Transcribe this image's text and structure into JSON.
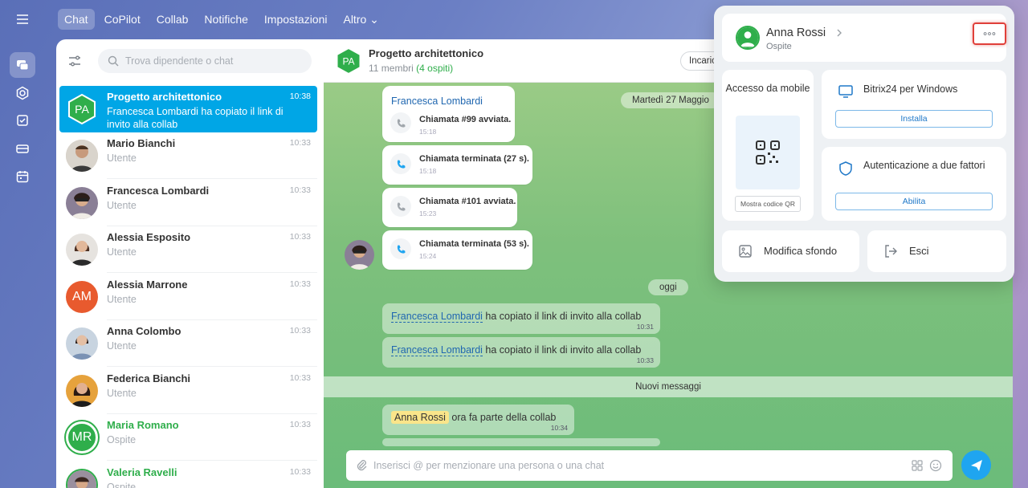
{
  "nav": {
    "tabs": [
      {
        "label": "Chat",
        "active": true
      },
      {
        "label": "CoPilot"
      },
      {
        "label": "Collab"
      },
      {
        "label": "Notifiche"
      },
      {
        "label": "Impostazioni"
      },
      {
        "label": "Altro ⌄"
      }
    ]
  },
  "rail_icons": [
    "menu-icon",
    "chat-icon",
    "hexagon-icon",
    "tasks-icon",
    "drive-icon",
    "calendar-icon"
  ],
  "search": {
    "placeholder": "Trova dipendente o chat"
  },
  "chats": [
    {
      "name": "Progetto architettonico",
      "time": "10:38",
      "subtitle": "Francesca Lombardi ha copiato il link di invito alla collab",
      "initials": "PA",
      "active": true
    },
    {
      "name": "Mario Bianchi",
      "time": "10:33",
      "subtitle": "Utente"
    },
    {
      "name": "Francesca Lombardi",
      "time": "10:33",
      "subtitle": "Utente"
    },
    {
      "name": "Alessia Esposito",
      "time": "10:33",
      "subtitle": "Utente"
    },
    {
      "name": "Alessia Marrone",
      "time": "10:33",
      "subtitle": "Utente",
      "initials": "AM"
    },
    {
      "name": "Anna Colombo",
      "time": "10:33",
      "subtitle": "Utente"
    },
    {
      "name": "Federica Bianchi",
      "time": "10:33",
      "subtitle": "Utente"
    },
    {
      "name": "Maria Romano",
      "time": "10:33",
      "subtitle": "Ospite",
      "initials": "MR"
    },
    {
      "name": "Valeria Ravelli",
      "time": "10:33",
      "subtitle": "Ospite"
    }
  ],
  "chat": {
    "title": "Progetto architettonico",
    "members": "11 membri",
    "guests": "(4 ospiti)",
    "task_button": "Incaric",
    "sender": "Francesca Lombardi",
    "date_pill": "Martedì 27 Maggio",
    "calls": [
      {
        "text": "Chiamata #99 avviata.",
        "time": "15:18"
      },
      {
        "text": "Chiamata terminata (27 s).",
        "time": "15:18"
      },
      {
        "text": "Chiamata #101 avviata.",
        "time": "15:23"
      },
      {
        "text": "Chiamata terminata (53 s).",
        "time": "15:24"
      }
    ],
    "today_pill": "oggi",
    "system_messages": [
      {
        "link": "Francesca Lombardi",
        "text": " ha copiato il link di invito alla collab",
        "time": "10:31"
      },
      {
        "link": "Francesca Lombardi",
        "text": " ha copiato il link di invito alla collab",
        "time": "10:33"
      }
    ],
    "new_messages": "Nuovi messaggi",
    "joined": {
      "name": "Anna Rossi",
      "text": " ora fa parte della collab",
      "time": "10:34"
    },
    "composer_placeholder": "Inserisci @ per menzionare una persona o una chat"
  },
  "popup": {
    "user_name": "Anna Rossi",
    "user_role": "Ospite",
    "mobile_label": "Accesso da mobile",
    "qr_button": "Mostra codice QR",
    "windows_title": "Bitrix24 per Windows",
    "windows_button": "Installa",
    "twofa_title": "Autenticazione a due fattori",
    "twofa_button": "Abilita",
    "background_label": "Modifica sfondo",
    "logout_label": "Esci"
  },
  "colors": {
    "accent": "#00a6e6",
    "guest": "#2fae4b",
    "send": "#1fa5f0",
    "highlight": "#e0403a"
  }
}
